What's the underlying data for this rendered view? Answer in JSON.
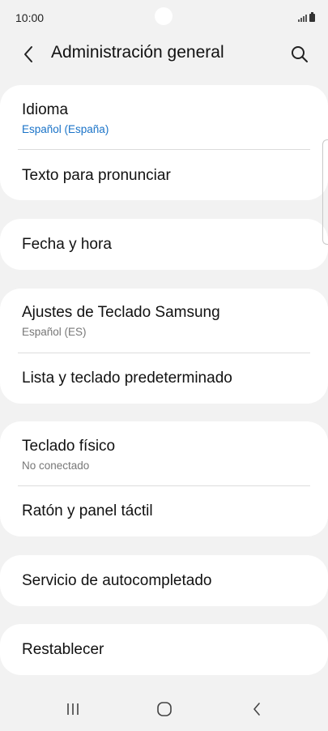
{
  "status_bar": {
    "time": "10:00"
  },
  "header": {
    "title": "Administración general",
    "back_icon": "chevron-left-icon",
    "search_icon": "search-icon"
  },
  "settings": {
    "idioma": {
      "title": "Idioma",
      "subtitle": "Español (España)"
    },
    "texto": {
      "title": "Texto para pronunciar"
    },
    "fecha": {
      "title": "Fecha y hora"
    },
    "ajustes_teclado": {
      "title": "Ajustes de Teclado Samsung",
      "subtitle": "Español (ES)"
    },
    "lista_teclado": {
      "title": "Lista y teclado predeterminado"
    },
    "teclado_fisico": {
      "title": "Teclado físico",
      "subtitle": "No conectado"
    },
    "raton": {
      "title": "Ratón y panel táctil"
    },
    "autocompletado": {
      "title": "Servicio de autocompletado"
    },
    "restablecer": {
      "title": "Restablecer"
    }
  },
  "colors": {
    "background": "#f2f2f2",
    "card": "#ffffff",
    "accent_subtitle": "#1a73c8"
  },
  "nav_bar": {
    "recents_icon": "recents-icon",
    "home_icon": "home-icon",
    "back_icon": "back-icon"
  }
}
